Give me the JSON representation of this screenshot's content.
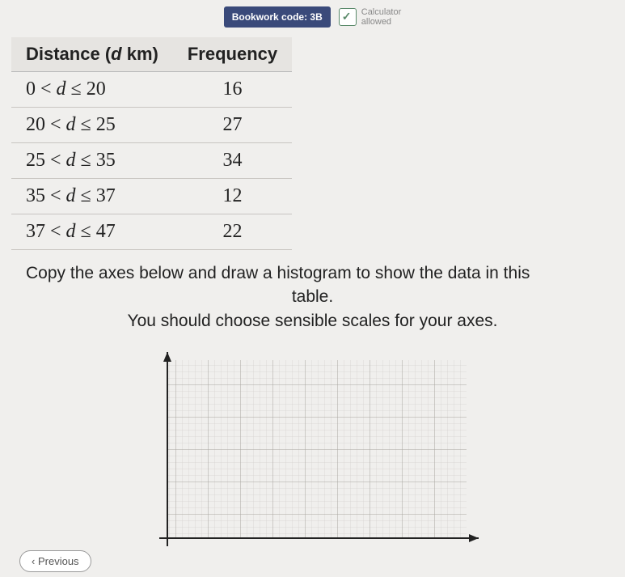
{
  "header": {
    "bookwork_label": "Bookwork code: 3B",
    "calc_line1": "Calculator",
    "calc_line2": "allowed"
  },
  "table": {
    "col1": "Distance (d km)",
    "col2": "Frequency",
    "rows": [
      {
        "range": "0 < d ≤ 20",
        "freq": "16"
      },
      {
        "range": "20 < d ≤ 25",
        "freq": "27"
      },
      {
        "range": "25 < d ≤ 35",
        "freq": "34"
      },
      {
        "range": "35 < d ≤ 37",
        "freq": "12"
      },
      {
        "range": "37 < d ≤ 47",
        "freq": "22"
      }
    ]
  },
  "instruction": {
    "line1": "Copy the axes below and draw a histogram to show the data in this",
    "line2": "table.",
    "line3": "You should choose sensible scales for your axes."
  },
  "footer": {
    "previous": "Previous"
  },
  "chart_data": {
    "type": "bar",
    "title": "",
    "xlabel": "",
    "ylabel": "",
    "categories": [],
    "values": [],
    "note": "blank axes / grid only — no data plotted"
  }
}
